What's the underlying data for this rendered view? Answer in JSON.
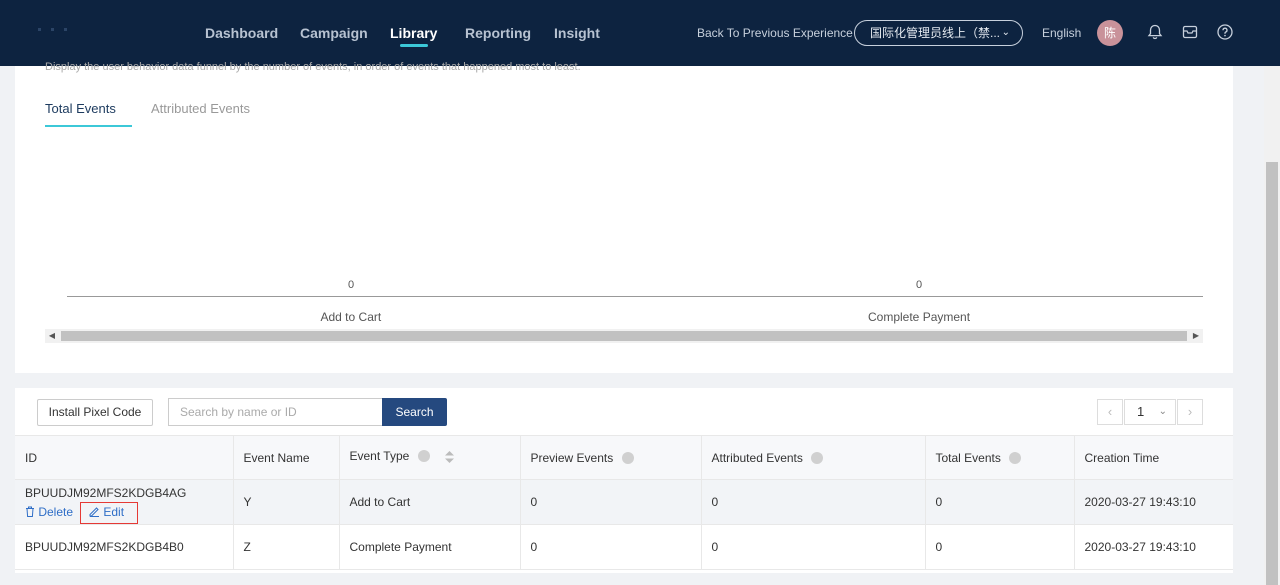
{
  "nav": {
    "items": [
      {
        "label": "Dashboard",
        "active": false
      },
      {
        "label": "Campaign",
        "active": false
      },
      {
        "label": "Library",
        "active": true
      },
      {
        "label": "Reporting",
        "active": false
      },
      {
        "label": "Insight",
        "active": false
      }
    ],
    "back_link": "Back To Previous Experience",
    "account": "国际化管理员线上（禁...",
    "language": "English",
    "avatar_text": "陈",
    "icons": [
      "bell-icon",
      "message-icon",
      "help-icon"
    ]
  },
  "funnel": {
    "description": "Display the user behavior data funnel by the number of events, in order of events that happened most to least.",
    "tabs": [
      {
        "label": "Total Events",
        "active": true
      },
      {
        "label": "Attributed Events",
        "active": false
      }
    ]
  },
  "chart_data": {
    "type": "bar",
    "categories": [
      "Add to Cart",
      "Complete Payment"
    ],
    "values": [
      0,
      0
    ],
    "title": "",
    "xlabel": "",
    "ylabel": "",
    "grid": false
  },
  "toolbar": {
    "install_label": "Install Pixel Code",
    "search_placeholder": "Search by name or ID",
    "search_label": "Search",
    "page": "1"
  },
  "table": {
    "columns": [
      "ID",
      "Event Name",
      "Event Type",
      "Preview Events",
      "Attributed Events",
      "Total Events",
      "Creation Time"
    ],
    "rows": [
      {
        "id": "BPUUDJM92MFS2KDGB4AG",
        "name": "Y",
        "type": "Add to Cart",
        "preview": "0",
        "attributed": "0",
        "total": "0",
        "time": "2020-03-27 19:43:10"
      },
      {
        "id": "BPUUDJM92MFS2KDGB4B0",
        "name": "Z",
        "type": "Complete Payment",
        "preview": "0",
        "attributed": "0",
        "total": "0",
        "time": "2020-03-27 19:43:10"
      }
    ],
    "row_actions": {
      "delete": "Delete",
      "edit": "Edit"
    }
  }
}
